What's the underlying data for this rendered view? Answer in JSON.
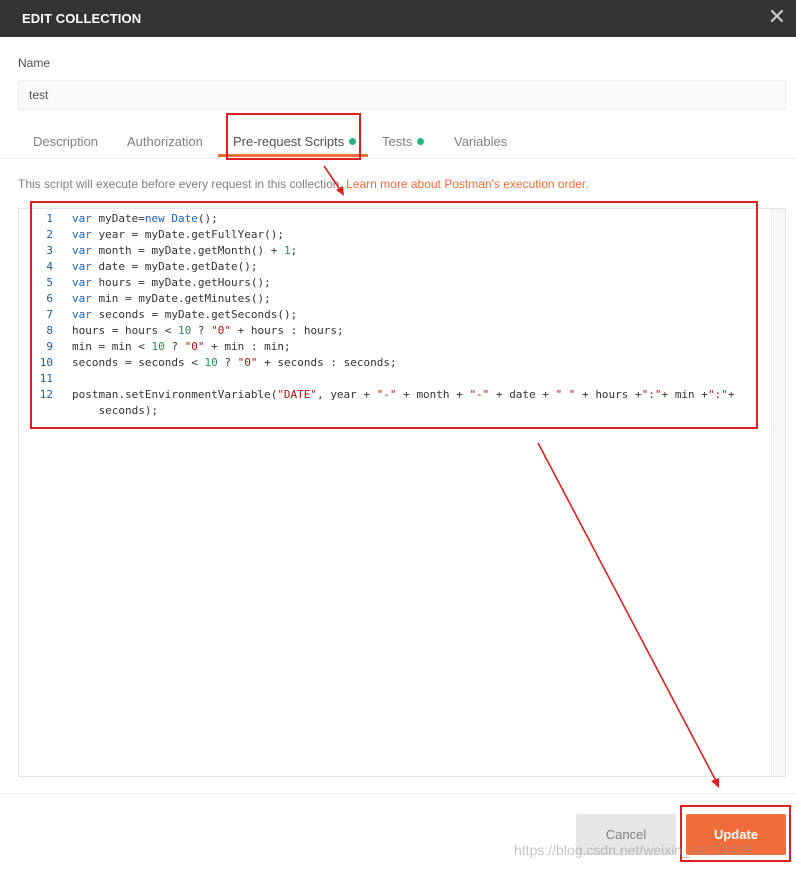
{
  "dialog": {
    "title": "EDIT COLLECTION",
    "close_glyph": "✕"
  },
  "name_field": {
    "label": "Name",
    "value": "test"
  },
  "tabs": [
    {
      "label": "Description",
      "active": false,
      "has_dot": false
    },
    {
      "label": "Authorization",
      "active": false,
      "has_dot": false
    },
    {
      "label": "Pre-request Scripts",
      "active": true,
      "has_dot": true
    },
    {
      "label": "Tests",
      "active": false,
      "has_dot": true
    },
    {
      "label": "Variables",
      "active": false,
      "has_dot": false
    }
  ],
  "info": {
    "text": "This script will execute before every request in this collection.",
    "link": "Learn more about Postman's execution order."
  },
  "code_lines": [
    {
      "num": "1",
      "text": "var myDate=new Date();"
    },
    {
      "num": "2",
      "text": "var year = myDate.getFullYear();"
    },
    {
      "num": "3",
      "text": "var month = myDate.getMonth() + 1;"
    },
    {
      "num": "4",
      "text": "var date = myDate.getDate();"
    },
    {
      "num": "5",
      "text": "var hours = myDate.getHours();"
    },
    {
      "num": "6",
      "text": "var min = myDate.getMinutes();"
    },
    {
      "num": "7",
      "text": "var seconds = myDate.getSeconds();"
    },
    {
      "num": "8",
      "text": "hours = hours < 10 ? \"0\" + hours : hours;"
    },
    {
      "num": "9",
      "text": "min = min < 10 ? \"0\" + min : min;"
    },
    {
      "num": "10",
      "text": "seconds = seconds < 10 ? \"0\" + seconds : seconds;"
    },
    {
      "num": "11",
      "text": ""
    },
    {
      "num": "12",
      "text": "postman.setEnvironmentVariable(\"DATE\", year + \"-\" + month + \"-\" + date + \" \" + hours +\":\"+ min +\":\"+\n    seconds);"
    }
  ],
  "buttons": {
    "cancel": "Cancel",
    "update": "Update"
  },
  "watermark": "https://blog.csdn.net/weixin_44773418",
  "colors": {
    "accent": "#f26b3a",
    "titlebar": "#333333",
    "dot": "#26b47f",
    "annotation": "#e02020"
  }
}
